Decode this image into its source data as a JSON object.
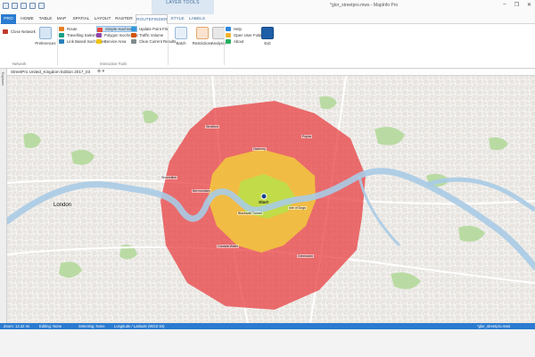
{
  "app": {
    "window_title": "*glor_streetpro.mws - MapInfo Pro",
    "context_title": "LAYER TOOLS",
    "controls": [
      "–",
      "❐",
      "✕"
    ]
  },
  "tabs": {
    "pro": "PRO",
    "home": "HOME",
    "table": "TABLE",
    "map": "MAP",
    "spatial": "SPATIAL",
    "layout": "LAYOUT",
    "raster": "RASTER",
    "routefinder": "ROUTEFINDER",
    "style": "STYLE",
    "labels": "LABELS"
  },
  "ribbon": {
    "close_network": "Close Network",
    "preferences": "Preferences",
    "network_group": "Network",
    "route": "Route",
    "travelling_salesman": "Travelling Salesman",
    "link_based_isochrones": "Link Based Isochrones",
    "simple_isochrones": "Simple Isochrones",
    "polygon_isochrones": "Polygon Isochrones",
    "service_area": "Service Area",
    "interactive_group": "Interactive Tools",
    "update_point_file": "Update Point File",
    "traffic_volume": "Traffic Volume",
    "clear_current_results": "Clear Current Results",
    "batch": "Batch",
    "restrictions": "Restrictions",
    "analysis": "Analysis",
    "help": "Help",
    "open_user_folder": "Open User Folder",
    "about": "About",
    "exit": "Exit"
  },
  "side_panel": {
    "label": "Explorer"
  },
  "map_window": {
    "title": "StreetPro United_Kingdom Edition 2017_03",
    "close": "⊗ ▾"
  },
  "map": {
    "city_label": "London",
    "start_label": "Start",
    "place_labels": [
      "Stratford",
      "Hackney",
      "Shoreditch",
      "Poplar",
      "Bermondsey",
      "Canada Water",
      "Greenwich",
      "Isle of Dogs",
      "Blackwall Tunnel"
    ],
    "colors": {
      "outer_zone": "#e8393c",
      "middle_zone": "#f2d13a",
      "inner_zone": "#b8e04a",
      "river": "#a9cbe6",
      "park": "#b9dba3"
    }
  },
  "status": {
    "zoom": "Zoom: 13.32 mi",
    "editing": "Editing: None",
    "selecting": "Selecting: None",
    "projection": "Longitude / Latitude (WGS 84)",
    "workspace": "*glor_streetpro.mws"
  }
}
